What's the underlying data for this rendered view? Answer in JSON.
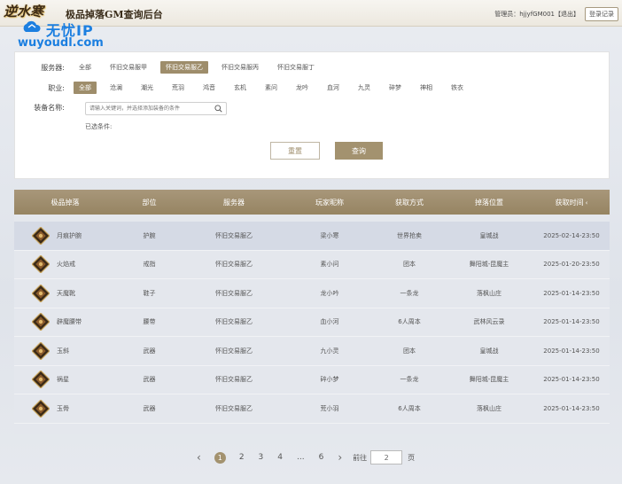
{
  "header": {
    "logo_text": "逆水寒",
    "title": "极品掉落GM查询后台",
    "admin": "管理员：hjjyfGM001【退出】",
    "logout": "登录记录"
  },
  "watermark": {
    "line1": "无忧IP",
    "line2": "wuyoudl.com"
  },
  "filters": {
    "server_label": "服务器:",
    "servers": [
      {
        "label": "全部",
        "active": false
      },
      {
        "label": "怀旧交易服甲",
        "active": false
      },
      {
        "label": "怀旧交易服乙",
        "active": true
      },
      {
        "label": "怀旧交易服丙",
        "active": false
      },
      {
        "label": "怀旧交易服丁",
        "active": false
      }
    ],
    "class_label": "职业:",
    "classes": [
      {
        "label": "全部",
        "active": true
      },
      {
        "label": "沧澜",
        "active": false
      },
      {
        "label": "潮光",
        "active": false
      },
      {
        "label": "荒羽",
        "active": false
      },
      {
        "label": "鸿音",
        "active": false
      },
      {
        "label": "玄机",
        "active": false
      },
      {
        "label": "素问",
        "active": false
      },
      {
        "label": "龙吟",
        "active": false
      },
      {
        "label": "血河",
        "active": false
      },
      {
        "label": "九灵",
        "active": false
      },
      {
        "label": "碎梦",
        "active": false
      },
      {
        "label": "神相",
        "active": false
      },
      {
        "label": "铁衣",
        "active": false
      }
    ],
    "equip_label": "装备名称:",
    "equip_placeholder": "请输入关键词，并选择添加装备的条件",
    "selected_label": "已选条件:",
    "reset_label": "重置",
    "query_label": "查询"
  },
  "table": {
    "headers": [
      "极品掉落",
      "部位",
      "服务器",
      "玩家昵称",
      "获取方式",
      "掉落位置",
      "获取时间"
    ],
    "sort_indicator": "‹",
    "rows": [
      {
        "item": "月痕护腕",
        "slot": "护腕",
        "server": "怀旧交易服乙",
        "player": "梁小寒",
        "method": "世界抢卖",
        "location": "皇城战",
        "time": "2025-02-14-23:50",
        "highlight": true
      },
      {
        "item": "火焰戒",
        "slot": "戒指",
        "server": "怀旧交易服乙",
        "player": "素小问",
        "method": "团本",
        "location": "舞阳城-昆魔主",
        "time": "2025-01-20-23:50",
        "highlight": false
      },
      {
        "item": "天魔靴",
        "slot": "鞋子",
        "server": "怀旧交易服乙",
        "player": "龙小吟",
        "method": "一条龙",
        "location": "落枫山庄",
        "time": "2025-01-14-23:50",
        "highlight": false
      },
      {
        "item": "辟魔腰带",
        "slot": "腰带",
        "server": "怀旧交易服乙",
        "player": "血小河",
        "method": "6人周本",
        "location": "武林风云录",
        "time": "2025-01-14-23:50",
        "highlight": false
      },
      {
        "item": "玉斜",
        "slot": "武器",
        "server": "怀旧交易服乙",
        "player": "九小灵",
        "method": "团本",
        "location": "皇城战",
        "time": "2025-01-14-23:50",
        "highlight": false
      },
      {
        "item": "祸星",
        "slot": "武器",
        "server": "怀旧交易服乙",
        "player": "碎小梦",
        "method": "一条龙",
        "location": "舞阳城-昆魔主",
        "time": "2025-01-14-23:50",
        "highlight": false
      },
      {
        "item": "玉骨",
        "slot": "武器",
        "server": "怀旧交易服乙",
        "player": "荒小羽",
        "method": "6人周本",
        "location": "落枫山庄",
        "time": "2025-01-14-23:50",
        "highlight": false
      }
    ]
  },
  "pagination": {
    "prev": "‹",
    "pages": [
      "1",
      "2",
      "3",
      "4",
      "...",
      "6"
    ],
    "active_page": "1",
    "next": "›",
    "goto_label": "前往",
    "goto_value": "2",
    "unit": "页"
  }
}
